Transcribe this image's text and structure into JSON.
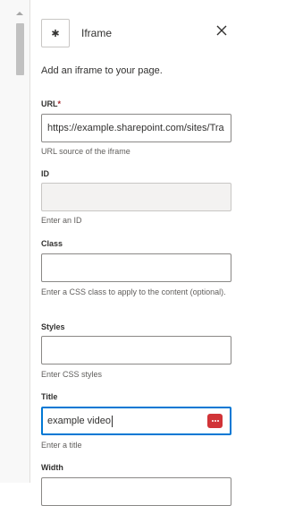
{
  "panel": {
    "title": "Iframe",
    "description": "Add an iframe to your page.",
    "icon": "asterisk-icon",
    "close_icon": "close-icon"
  },
  "fields": {
    "url": {
      "label": "URL",
      "required_mark": "*",
      "value": "https://example.sharepoint.com/sites/Tra",
      "help": "URL source of the iframe"
    },
    "id": {
      "label": "ID",
      "value": "",
      "help": "Enter an ID"
    },
    "class": {
      "label": "Class",
      "value": "",
      "help": "Enter a CSS class to apply to the content (optional)."
    },
    "styles": {
      "label": "Styles",
      "value": "",
      "help": "Enter CSS styles"
    },
    "title": {
      "label": "Title",
      "value": "example video",
      "help": "Enter a title",
      "autofill_icon": "password-manager-icon"
    },
    "width": {
      "label": "Width"
    }
  },
  "colors": {
    "accent": "#0078d4",
    "required": "#a4262c",
    "password_manager": "#d13438"
  }
}
